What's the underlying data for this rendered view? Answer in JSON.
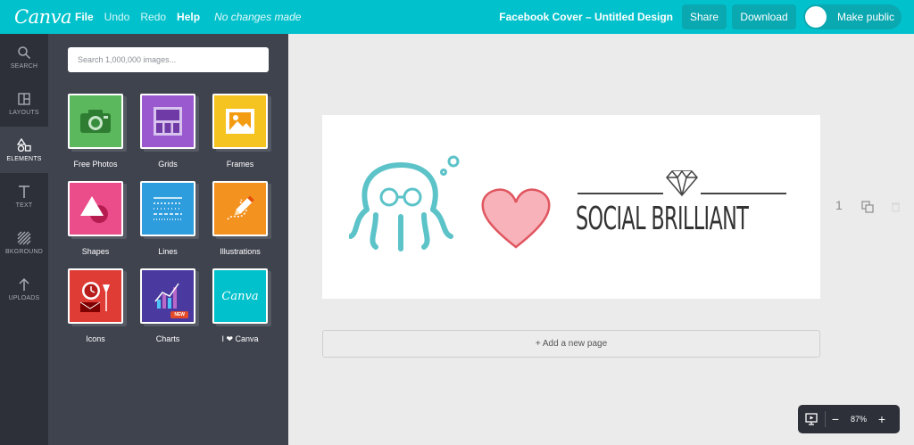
{
  "header": {
    "logo": "Canva",
    "menu": [
      "File",
      "Undo",
      "Redo",
      "Help"
    ],
    "status": "No changes made",
    "doc_title": "Facebook Cover – Untitled Design",
    "share": "Share",
    "download": "Download",
    "make_public": "Make public"
  },
  "rail": {
    "items": [
      {
        "label": "SEARCH",
        "icon": "search-icon"
      },
      {
        "label": "LAYOUTS",
        "icon": "layouts-icon"
      },
      {
        "label": "ELEMENTS",
        "icon": "elements-icon",
        "active": true
      },
      {
        "label": "TEXT",
        "icon": "text-icon"
      },
      {
        "label": "BKGROUND",
        "icon": "background-icon"
      },
      {
        "label": "UPLOADS",
        "icon": "upload-icon"
      }
    ]
  },
  "panel": {
    "search_placeholder": "Search 1,000,000 images...",
    "tiles": [
      {
        "label": "Free Photos",
        "color": "#5cb85c",
        "icon": "camera-icon"
      },
      {
        "label": "Grids",
        "color": "#9b59d0",
        "icon": "grid-icon"
      },
      {
        "label": "Frames",
        "color": "#f6c421",
        "icon": "frame-icon"
      },
      {
        "label": "Shapes",
        "color": "#ea4d8a",
        "icon": "shapes-icon"
      },
      {
        "label": "Lines",
        "color": "#2d9ddd",
        "icon": "lines-icon"
      },
      {
        "label": "Illustrations",
        "color": "#f4921f",
        "icon": "pencil-icon"
      },
      {
        "label": "Icons",
        "color": "#e03c36",
        "icon": "clock-icon"
      },
      {
        "label": "Charts",
        "color": "#4a3aa0",
        "icon": "chart-icon",
        "badge": "NEW"
      },
      {
        "label": "I ❤ Canva",
        "color": "#01c2cc",
        "icon": "canva-logo-icon",
        "logo_text": "Canva"
      }
    ]
  },
  "canvas": {
    "logo_text": "SOCIAL BRILLIANT",
    "page_number": "1",
    "add_page": "+ Add a new page"
  },
  "zoom": {
    "value": "87%",
    "minus": "−",
    "plus": "+"
  },
  "colors": {
    "brand": "#01c2cc",
    "octopus": "#5cc3c9",
    "heart": "#f0838e"
  }
}
